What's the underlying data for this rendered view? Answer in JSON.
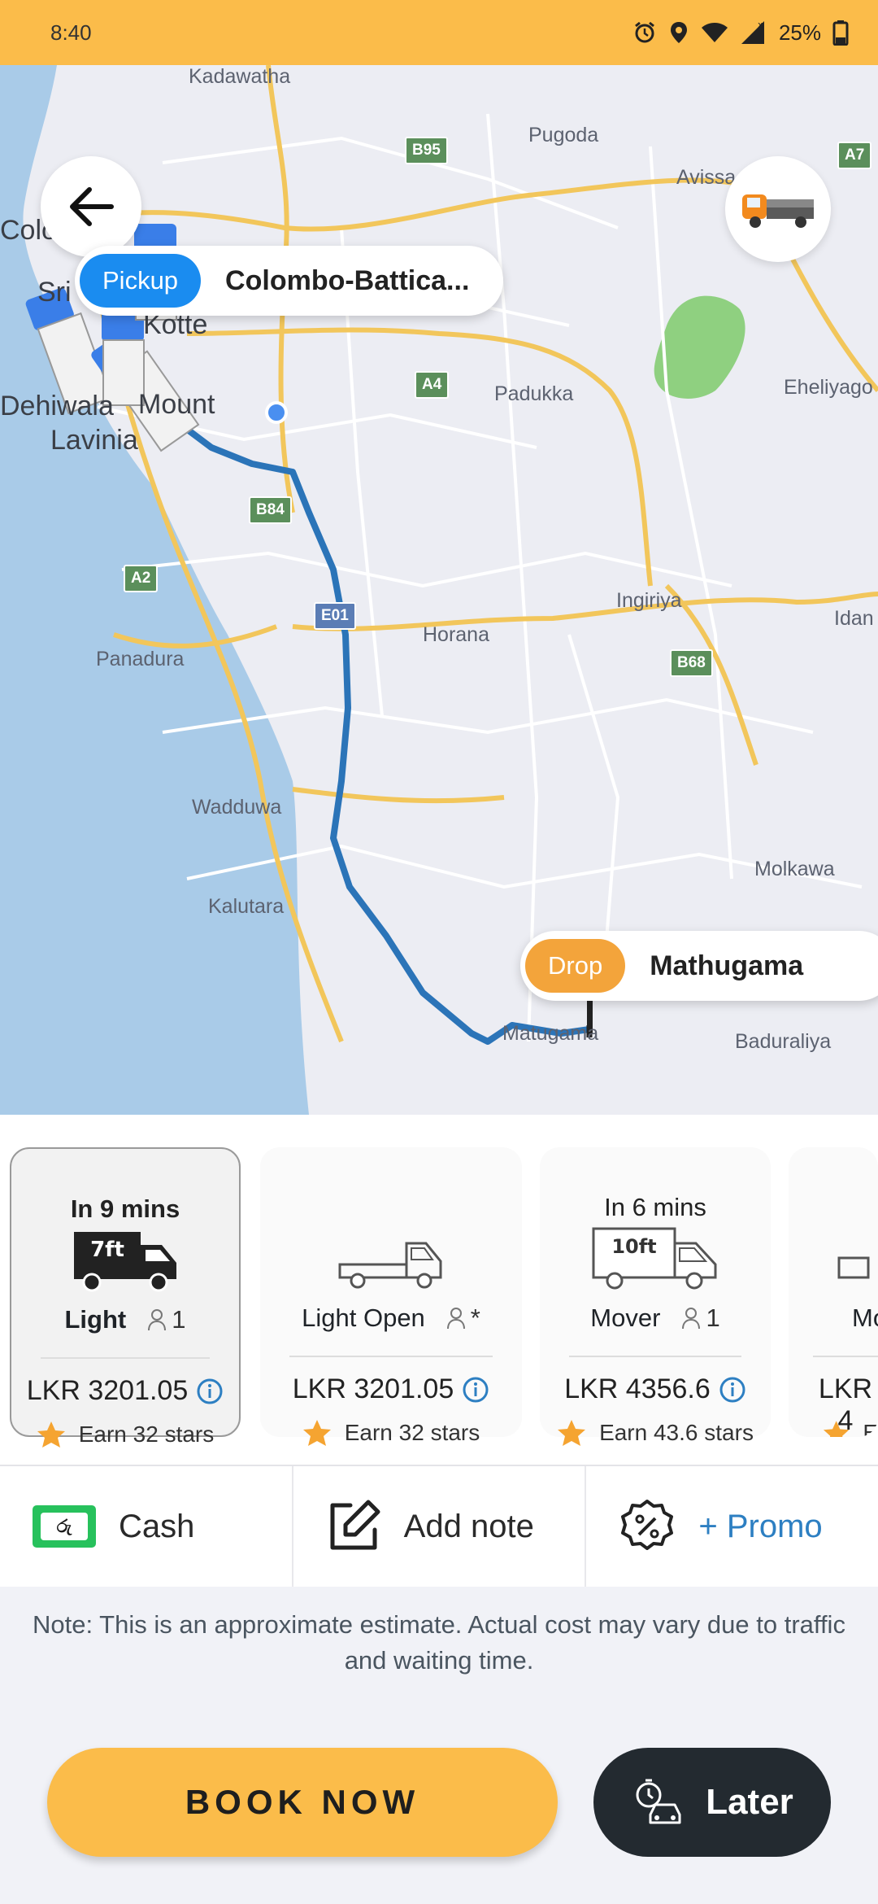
{
  "status_bar": {
    "time": "8:40",
    "battery": "25%",
    "icons": [
      "alarm-icon",
      "location-icon",
      "wifi-icon",
      "signal-icon",
      "battery-icon"
    ]
  },
  "map": {
    "labels": {
      "kadawatha": "Kadawatha",
      "colombo": "Colombo",
      "sri": "Sri",
      "kotte": "Kotte",
      "dehiwala": "Dehiwala",
      "mount": "Mount",
      "lavinia": "Lavinia",
      "pugoda": "Pugoda",
      "avissa": "Avissa",
      "padukka": "Padukka",
      "eheliyago": "Eheliyago",
      "ingiriya": "Ingiriya",
      "idan": "Idan",
      "horana": "Horana",
      "panadura": "Panadura",
      "wadduwa": "Wadduwa",
      "molkawa": "Molkawa",
      "kalutara": "Kalutara",
      "matugama": "Matugama",
      "baduraliya": "Baduraliya"
    },
    "shields": {
      "b95": "B95",
      "a7": "A7",
      "a4": "A4",
      "b84": "B84",
      "a2": "A2",
      "e01": "E01",
      "b68": "B68"
    },
    "pickup": {
      "tag": "Pickup",
      "location": "Colombo-Battica..."
    },
    "drop": {
      "tag": "Drop",
      "location": "Mathugama"
    }
  },
  "vehicles": [
    {
      "eta": "In 9 mins",
      "size_label": "7ft",
      "name": "Light",
      "seats": "1",
      "price": "LKR 3201.05",
      "stars": "Earn 32 stars",
      "selected": true
    },
    {
      "eta": "",
      "size_label": "",
      "name": "Light Open",
      "seats": "*",
      "price": "LKR 3201.05",
      "stars": "Earn 32 stars",
      "selected": false
    },
    {
      "eta": "In 6 mins",
      "size_label": "10ft",
      "name": "Mover",
      "seats": "1",
      "price": "LKR 4356.6",
      "stars": "Earn 43.6 stars",
      "selected": false
    },
    {
      "eta": "",
      "size_label": "",
      "name": "Mo",
      "seats": "",
      "price": "LKR 4",
      "stars": "E",
      "selected": false
    }
  ],
  "actions": {
    "cash": "Cash",
    "cash_icon_text": "රු",
    "note": "Add note",
    "promo": "+ Promo"
  },
  "disclaimer": "Note: This is an approximate estimate. Actual cost may vary due to traffic and waiting time.",
  "buttons": {
    "book_now": "BOOK NOW",
    "later": "Later"
  },
  "colors": {
    "brand": "#fbbc4a",
    "pickup": "#1a8cf0",
    "drop": "#f3a43b",
    "route": "#2b74b8",
    "dark_button": "#232a30"
  }
}
